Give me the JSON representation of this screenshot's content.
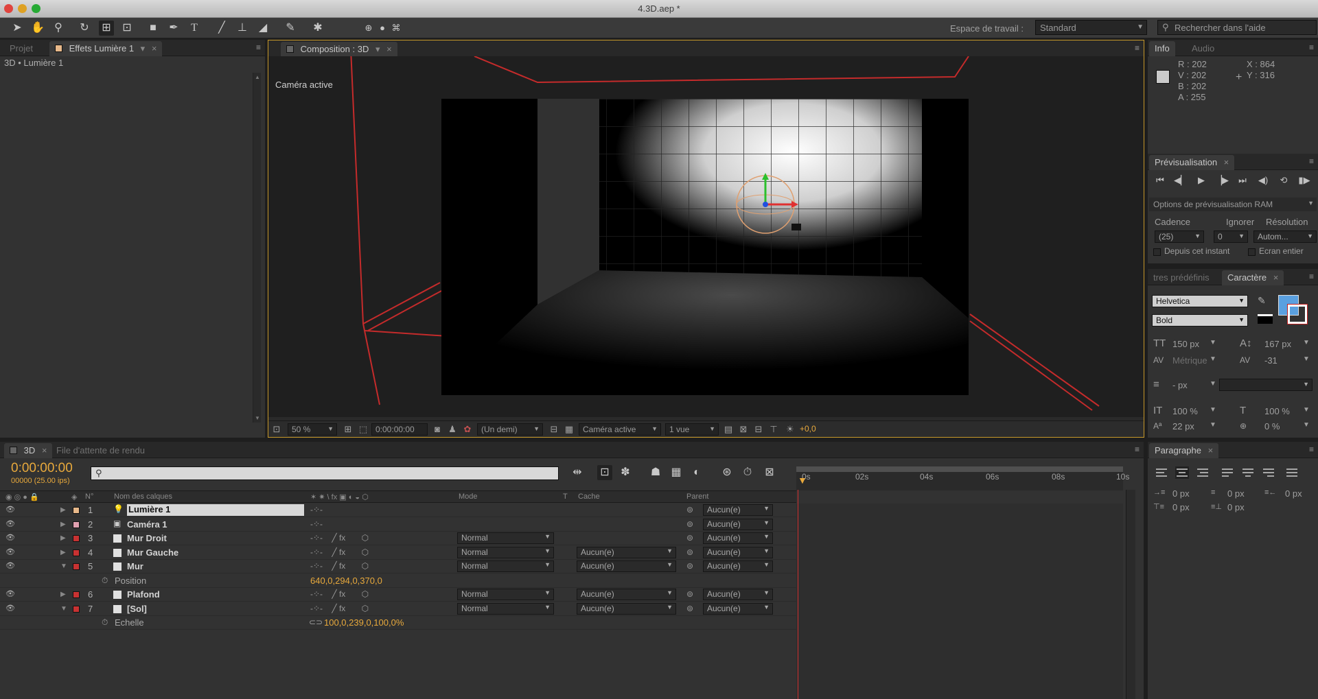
{
  "window": {
    "title": "4.3D.aep *"
  },
  "workspace": {
    "label": "Espace de travail :",
    "value": "Standard"
  },
  "help": {
    "placeholder": "Rechercher dans l'aide"
  },
  "project_panel": {
    "tab_project": "Projet",
    "tab_effects": "Effets Lumière 1",
    "breadcrumb": "3D • Lumière 1"
  },
  "composition": {
    "tab": "Composition : 3D",
    "subtab": "3D",
    "view_label": "Caméra active"
  },
  "viewer_bar": {
    "zoom": "50 %",
    "timecode": "0:00:00:00",
    "resolution": "(Un demi)",
    "camera": "Caméra active",
    "views": "1 vue",
    "exposure": "+0,0"
  },
  "info": {
    "tab_info": "Info",
    "tab_audio": "Audio",
    "r": "R : 202",
    "v": "V : 202",
    "b": "B : 202",
    "a": "A : 255",
    "x": "X : 864",
    "y": "Y : 316"
  },
  "preview": {
    "tab": "Prévisualisation",
    "ram_options": "Options de prévisualisation RAM",
    "cadence_label": "Cadence",
    "ignore_label": "Ignorer",
    "resolution_label": "Résolution",
    "cadence_value": "(25)",
    "ignore_value": "0",
    "resolution_value": "Autom...",
    "from_here": "Depuis cet instant",
    "fullscreen": "Ecran entier"
  },
  "character": {
    "tab_presets": "tres prédéfinis",
    "tab": "Caractère",
    "font": "Helvetica",
    "style": "Bold",
    "size": "150 px",
    "leading": "167 px",
    "kerning": "Métrique",
    "tracking": "-31",
    "stroke": "- px",
    "vscale": "100 %",
    "hscale": "100 %",
    "baseline": "22 px",
    "tsume": "0 %",
    "fill_color": "#5aa0e0"
  },
  "paragraph": {
    "tab": "Paragraphe",
    "indent_left": "0 px",
    "indent_first": "0 px",
    "indent_right": "0 px",
    "space_before": "0 px",
    "space_after": "0 px"
  },
  "timeline": {
    "tab": "3D",
    "tab_render": "File d'attente de rendu",
    "timecode": "0:00:00:00",
    "frames": "00000 (25.00 ips)",
    "ruler": [
      "0s",
      "02s",
      "04s",
      "06s",
      "08s",
      "10s"
    ],
    "headers": {
      "num": "N°",
      "name": "Nom des calques",
      "mode": "Mode",
      "t": "T",
      "cache": "Cache",
      "parent": "Parent"
    },
    "layers": [
      {
        "num": "1",
        "name": "Lumière 1",
        "color": "#e8b98a",
        "type": "light",
        "mode": "",
        "cache": "",
        "parent": "Aucun(e)"
      },
      {
        "num": "2",
        "name": "Caméra 1",
        "color": "#e0a0b0",
        "type": "camera",
        "mode": "",
        "cache": "",
        "parent": "Aucun(e)"
      },
      {
        "num": "3",
        "name": "Mur Droit",
        "color": "#c83232",
        "type": "solid",
        "mode": "Normal",
        "cache": "",
        "parent": "Aucun(e)"
      },
      {
        "num": "4",
        "name": "Mur Gauche",
        "color": "#c83232",
        "type": "solid",
        "mode": "Normal",
        "cache": "Aucun(e)",
        "parent": "Aucun(e)"
      },
      {
        "num": "5",
        "name": "Mur",
        "color": "#c83232",
        "type": "solid",
        "mode": "Normal",
        "cache": "Aucun(e)",
        "parent": "Aucun(e)"
      },
      {
        "num": "6",
        "name": "Plafond",
        "color": "#c83232",
        "type": "solid",
        "mode": "Normal",
        "cache": "Aucun(e)",
        "parent": "Aucun(e)"
      },
      {
        "num": "7",
        "name": "[Sol]",
        "color": "#c83232",
        "type": "solid",
        "mode": "Normal",
        "cache": "Aucun(e)",
        "parent": "Aucun(e)"
      }
    ],
    "position_prop": {
      "name": "Position",
      "value": "640,0,294,0,370,0"
    },
    "scale_prop": {
      "name": "Echelle",
      "value": "100,0,239,0,100,0%"
    }
  },
  "colors": {
    "accent_orange": "#e8a93c",
    "layer_red": "#b83030",
    "light_bar": "#e0b893",
    "camera_bar": "#cf97a3"
  }
}
